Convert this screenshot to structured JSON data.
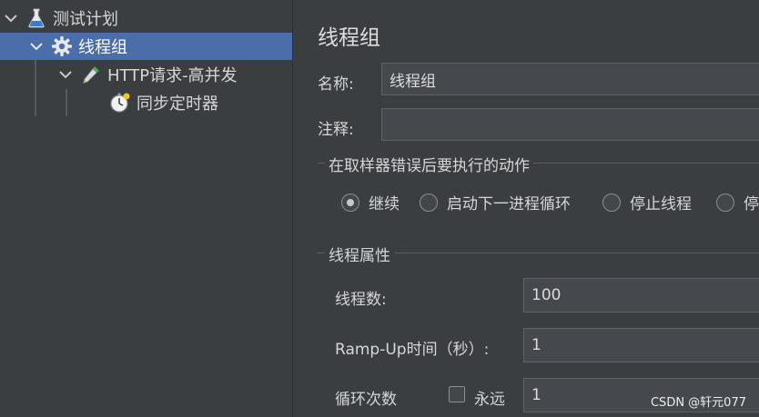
{
  "tree": {
    "items": [
      {
        "label": "测试计划",
        "icon": "flask-icon",
        "expanded": true
      },
      {
        "label": "线程组",
        "icon": "gear-icon",
        "expanded": true,
        "selected": true
      },
      {
        "label": "HTTP请求-高并发",
        "icon": "pipette-icon",
        "expanded": true
      },
      {
        "label": "同步定时器",
        "icon": "stopwatch-icon"
      }
    ]
  },
  "panel": {
    "title": "线程组",
    "name_label": "名称:",
    "name_value": "线程组",
    "comment_label": "注释:",
    "comment_value": "",
    "sampler_error": {
      "title": "在取样器错误后要执行的动作",
      "options": [
        "继续",
        "启动下一进程循环",
        "停止线程",
        "停"
      ],
      "selected": "继续"
    },
    "thread_props": {
      "title": "线程属性",
      "threads_label": "线程数:",
      "threads_value": "100",
      "rampup_label": "Ramp-Up时间（秒）:",
      "rampup_value": "1",
      "loop_label": "循环次数",
      "forever_label": "永远",
      "forever_checked": false,
      "loop_value": "1"
    }
  },
  "watermark": "CSDN @轩元077",
  "colors": {
    "background": "#3b3e41",
    "selected": "#4a6ea9",
    "field": "#45494d"
  }
}
